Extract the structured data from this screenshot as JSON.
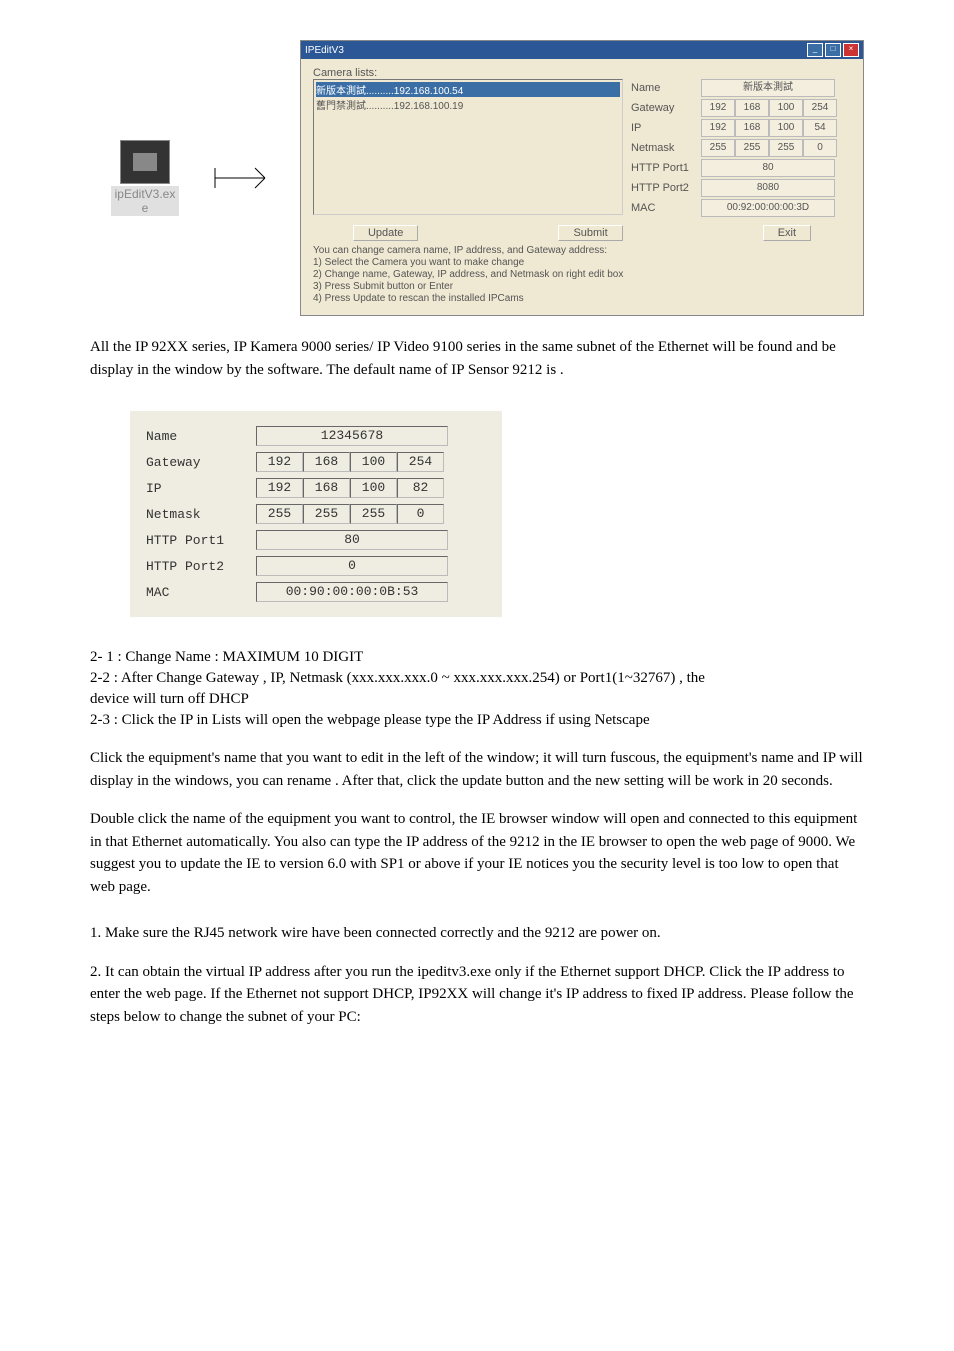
{
  "desktop_icon": {
    "label": "ipEditV3.ex\ne"
  },
  "dialog": {
    "title": "IPEditV3",
    "group_label": "Camera lists:",
    "camlist": {
      "row0": "新版本測試..........192.168.100.54",
      "row1": "舊門禁測試..........192.168.100.19"
    },
    "props": {
      "name_label": "Name",
      "name_value": "新版本測試",
      "gateway_label": "Gateway",
      "gw": [
        "192",
        "168",
        "100",
        "254"
      ],
      "ip_label": "IP",
      "ip": [
        "192",
        "168",
        "100",
        "54"
      ],
      "netmask_label": "Netmask",
      "nm": [
        "255",
        "255",
        "255",
        "0"
      ],
      "http1_label": "HTTP Port1",
      "http1": "80",
      "http2_label": "HTTP Port2",
      "http2": "8080",
      "mac_label": "MAC",
      "mac": "00:92:00:00:00:3D"
    },
    "buttons": {
      "update": "Update",
      "submit": "Submit",
      "exit": "Exit"
    },
    "instructions": "You can change camera name, IP address, and Gateway address:\n1) Select the Camera you want to make change\n2) Change name, Gateway, IP address, and Netmask on right edit box\n3) Press Submit button or Enter\n4) Press Update to rescan the installed IPCams"
  },
  "para1": "All the IP 92XX series, IP Kamera 9000 series/  IP Video 9100 series in the same subnet of the Ethernet will be found and be display in the window by the software. The default name of IP Sensor 9212 is                     .",
  "fig": {
    "rows": {
      "name": {
        "label": "Name",
        "value": "12345678"
      },
      "gateway": {
        "label": "Gateway",
        "v": [
          "192",
          "168",
          "100",
          "254"
        ]
      },
      "ip": {
        "label": "IP",
        "v": [
          "192",
          "168",
          "100",
          "82"
        ]
      },
      "netmask": {
        "label": "Netmask",
        "v": [
          "255",
          "255",
          "255",
          "0"
        ]
      },
      "http1": {
        "label": "HTTP Port1",
        "value": "80"
      },
      "http2": {
        "label": "HTTP Port2",
        "value": "0"
      },
      "mac": {
        "label": "MAC",
        "value": "00:90:00:00:0B:53"
      }
    }
  },
  "notes": {
    "n1": "2- 1  :  Change Name :  MAXIMUM  10 DIGIT",
    "n2": "2-2  : After  Change  Gateway  , IP, Netmask (xxx.xxx.xxx.0 ~ xxx.xxx.xxx.254) or  Port1(1~32767) , the",
    "n2b": "            device will  turn off DHCP",
    "n3": "2-3 : Click  the IP  in  Lists will open the webpage     please type the IP Address if using Netscape",
    "p1": "    Click the equipment's name that you want to edit in the left of the window; it will turn fuscous, the equipment's name and IP will display in the windows, you can rename . After that, click the update button and the new setting will be work in 20 seconds.",
    "p2": "    Double click the name of the equipment you want to control, the IE browser window will open and connected to this equipment in that Ethernet automatically. You also can type the IP address of the 9212 in the IE browser to open the web page of 9000. We suggest you to update the IE to version 6.0 with SP1 or above if your IE notices you the security level is too low to open that web page.",
    "p3": "1. Make sure the RJ45 network wire have been connected correctly and the 9212 are power on.",
    "p4": "2. It can obtain the virtual IP address after you run the ipeditv3.exe only if the Ethernet support DHCP. Click the IP address to enter the web page. If the Ethernet not support DHCP, IP92XX will change it's IP address to fixed IP address. Please follow the steps below to change the subnet of your PC:"
  }
}
